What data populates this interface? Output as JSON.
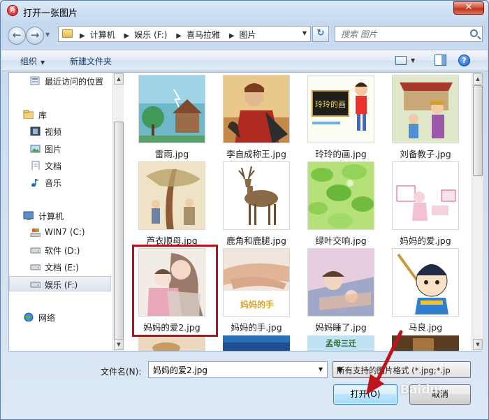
{
  "window": {
    "title": "打开一张图片",
    "close_glyph": "✕",
    "app_icon_glyph": "秀"
  },
  "nav": {
    "back_glyph": "←",
    "forward_glyph": "→",
    "breadcrumbs": [
      "计算机",
      "娱乐 (F:)",
      "喜马拉雅",
      "图片"
    ],
    "search_placeholder": "搜索 图片"
  },
  "toolbar": {
    "organize": "组织",
    "new_folder": "新建文件夹"
  },
  "sidebar": {
    "recent": "最近访问的位置",
    "libraries": "库",
    "videos": "视频",
    "pictures": "图片",
    "documents": "文档",
    "music": "音乐",
    "computer": "计算机",
    "drive_c": "WIN7 (C:)",
    "drive_d": "软件 (D:)",
    "drive_e": "文档 (E:)",
    "drive_f": "娱乐 (F:)",
    "network": "网络"
  },
  "files": [
    {
      "name": "雷雨.jpg"
    },
    {
      "name": "李自成称王.jpg"
    },
    {
      "name": "玲玲的画.jpg",
      "caption": "玲玲的画"
    },
    {
      "name": "刘备教子.jpg"
    },
    {
      "name": "芦衣顺母.jpg"
    },
    {
      "name": "鹿角和鹿腿.jpg"
    },
    {
      "name": "绿叶交响.jpg"
    },
    {
      "name": "妈妈的爱.jpg"
    },
    {
      "name": "妈妈的爱2.jpg",
      "selected": true
    },
    {
      "name": "妈妈的手.jpg",
      "caption": "妈妈的手"
    },
    {
      "name": "妈妈睡了.jpg"
    },
    {
      "name": "马良.jpg"
    },
    {
      "name": "",
      "caption": "孟母三迁"
    }
  ],
  "footer": {
    "filename_label": "文件名(N):",
    "filename_value": "妈妈的爱2.jpg",
    "filter_value": "所有支持的图片格式 (*.jpg;*.jp",
    "open_button": "打开(O)",
    "cancel_button": "取消",
    "watermark": "Baidu"
  },
  "colors": {
    "highlight": "#b0121e",
    "accent": "#3c7fb1"
  }
}
